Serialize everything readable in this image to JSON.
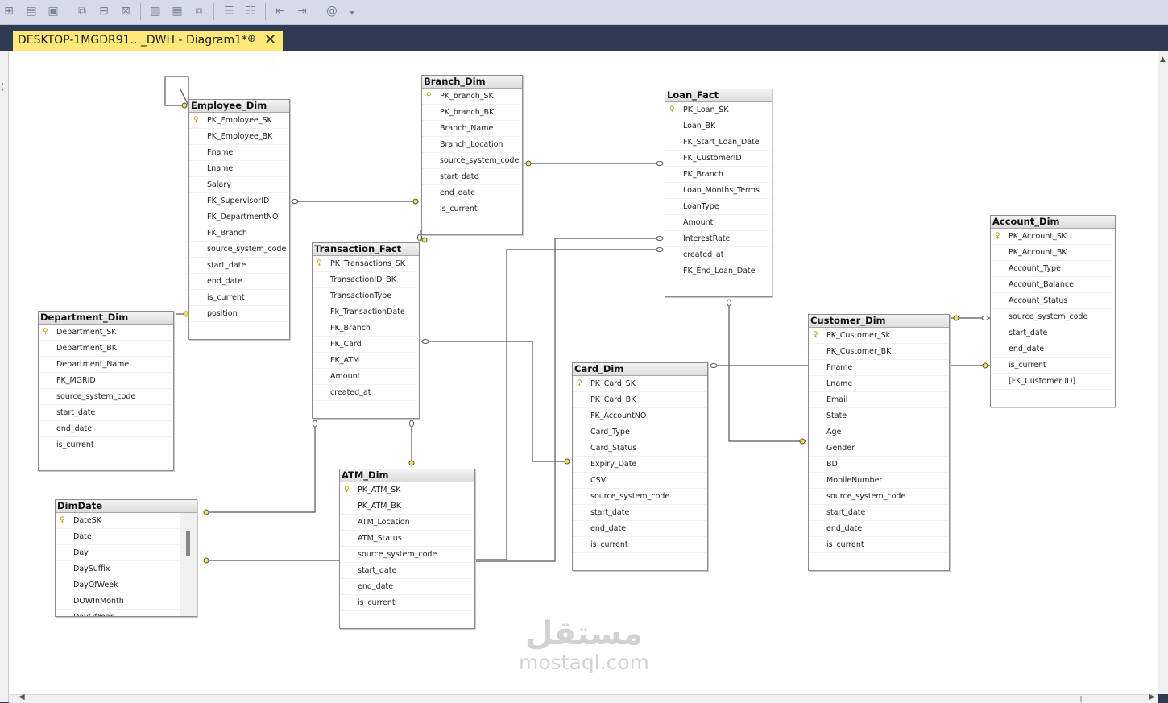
{
  "tab": {
    "title": "DESKTOP-1MGDR91..._DWH - Diagram1*",
    "pin_icon": "pin-icon",
    "close_icon": "close-icon"
  },
  "toolbar": {
    "icons": [
      "diagram-icon",
      "table-icon",
      "save-icon",
      "relationship-icon",
      "index-icon",
      "key-icon",
      "text-icon",
      "grid-icon",
      "arrange-icon",
      "list-icon",
      "list-indent-icon",
      "outdent-icon",
      "indent-icon",
      "autosize-icon",
      "overflow-icon"
    ]
  },
  "colors": {
    "tab_active": "#ffe87a",
    "chrome_dark": "#2d3a52",
    "key_yellow": "#b59a00"
  },
  "tables": {
    "employee": {
      "name": "Employee_Dim",
      "columns": [
        "PK_Employee_SK",
        "PK_Employee_BK",
        "Fname",
        "Lname",
        "Salary",
        "FK_SupervisorID",
        "FK_DepartmentNO",
        "FK_Branch",
        "source_system_code",
        "start_date",
        "end_date",
        "is_current",
        "position"
      ]
    },
    "branch": {
      "name": "Branch_Dim",
      "columns": [
        "PK_branch_SK",
        "PK_branch_BK",
        "Branch_Name",
        "Branch_Location",
        "source_system_code",
        "start_date",
        "end_date",
        "is_current"
      ]
    },
    "loan": {
      "name": "Loan_Fact",
      "columns": [
        "PK_Loan_SK",
        "Loan_BK",
        "FK_Start_Loan_Date",
        "FK_CustomerID",
        "FK_Branch",
        "Loan_Months_Terms",
        "LoanType",
        "Amount",
        "InterestRate",
        "created_at",
        "FK_End_Loan_Date"
      ]
    },
    "account": {
      "name": "Account_Dim",
      "columns": [
        "PK_Account_SK",
        "PK_Account_BK",
        "Account_Type",
        "Account_Balance",
        "Account_Status",
        "source_system_code",
        "start_date",
        "end_date",
        "is_current",
        "[FK_Customer ID]"
      ]
    },
    "transaction": {
      "name": "Transaction_Fact",
      "columns": [
        "PK_Transactions_SK",
        "TransactionID_BK",
        "TransactionType",
        "Fk_TransactionDate",
        "FK_Branch",
        "FK_Card",
        "FK_ATM",
        "Amount",
        "created_at"
      ]
    },
    "department": {
      "name": "Department_Dim",
      "columns": [
        "Department_SK",
        "Department_BK",
        "Department_Name",
        "FK_MGRID",
        "source_system_code",
        "start_date",
        "end_date",
        "is_current"
      ]
    },
    "customer": {
      "name": "Customer_Dim",
      "columns": [
        "PK_Customer_Sk",
        "PK_Customer_BK",
        "Fname",
        "Lname",
        "Email",
        "State",
        "Age",
        "Gender",
        "BD",
        "MobileNumber",
        "source_system_code",
        "start_date",
        "end_date",
        "is_current"
      ]
    },
    "card": {
      "name": "Card_Dim",
      "columns": [
        "PK_Card_SK",
        "PK_Card_BK",
        "FK_AccountNO",
        "Card_Type",
        "Card_Status",
        "Expiry_Date",
        "CSV",
        "source_system_code",
        "start_date",
        "end_date",
        "is_current"
      ]
    },
    "atm": {
      "name": "ATM_Dim",
      "columns": [
        "PK_ATM_SK",
        "PK_ATM_BK",
        "ATM_Location",
        "ATM_Status",
        "source_system_code",
        "start_date",
        "end_date",
        "is_current"
      ]
    },
    "date": {
      "name": "DimDate",
      "columns": [
        "DateSK",
        "Date",
        "Day",
        "DaySuffix",
        "DayOfWeek",
        "DOWInMonth",
        "DayOfYear"
      ]
    }
  },
  "watermark": {
    "arabic": "مستقل",
    "latin": "mostaql.com"
  }
}
